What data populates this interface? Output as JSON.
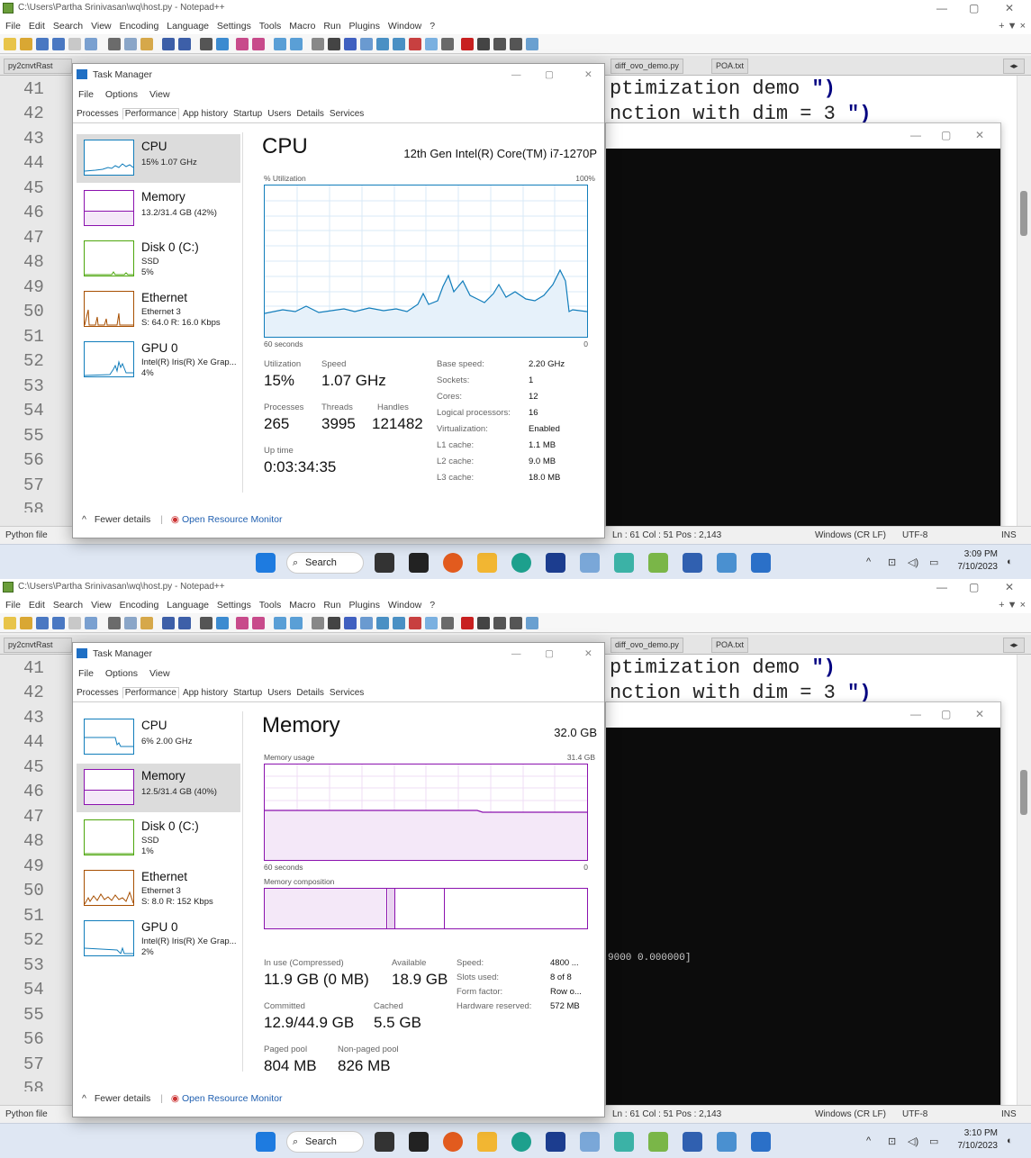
{
  "shots": [
    {
      "notepad": {
        "title": "C:\\Users\\Partha Srinivasan\\wq\\host.py - Notepad++",
        "menu": [
          "File",
          "Edit",
          "Search",
          "View",
          "Encoding",
          "Language",
          "Settings",
          "Tools",
          "Macro",
          "Run",
          "Plugins",
          "Window",
          "?"
        ],
        "menu_right": "+  ▼  ×",
        "tabs": [
          "py2cnvtRast",
          "diff_ovo_demo.py",
          "POA.txt"
        ],
        "lines": [
          "41",
          "42",
          "43",
          "44",
          "45",
          "46",
          "47",
          "48",
          "49",
          "50",
          "51",
          "52",
          "53",
          "54",
          "55",
          "56",
          "57",
          "58"
        ],
        "code_line1": "ptimization demo ",
        "code_line1_end": "\")",
        "code_line2": "nction with dim = 3 ",
        "code_line2_end": "\")",
        "status_type": "Python file",
        "status_pos": "Ln : 61   Col : 51   Pos : 2,143",
        "status_eol": "Windows (CR LF)",
        "status_enc": "UTF-8",
        "status_ins": "INS"
      },
      "console": {
        "text": ""
      },
      "taskbar": {
        "search": "Search",
        "time": "3:09 PM",
        "date": "7/10/2023"
      },
      "tm": {
        "title": "Task Manager",
        "menu": [
          "File",
          "Options",
          "View"
        ],
        "tabs": [
          "Processes",
          "Performance",
          "App history",
          "Startup",
          "Users",
          "Details",
          "Services"
        ],
        "side": [
          {
            "name": "CPU",
            "l1": "15% 1.07 GHz",
            "l2": "",
            "l3": ""
          },
          {
            "name": "Memory",
            "l1": "13.2/31.4 GB (42%)",
            "l2": "",
            "l3": ""
          },
          {
            "name": "Disk 0 (C:)",
            "l1": "SSD",
            "l2": "5%",
            "l3": ""
          },
          {
            "name": "Ethernet",
            "l1": "Ethernet 3",
            "l2": "S: 64.0  R: 16.0 Kbps",
            "l3": ""
          },
          {
            "name": "GPU 0",
            "l1": "Intel(R) Iris(R) Xe Grap...",
            "l2": "4%",
            "l3": ""
          }
        ],
        "header": "CPU",
        "header_right": "12th Gen Intel(R) Core(TM) i7-1270P",
        "util_label": "% Utilization",
        "util_max": "100%",
        "sec_label": "60 seconds",
        "zero": "0",
        "stats": {
          "utilization_label": "Utilization",
          "utilization": "15%",
          "speed_label": "Speed",
          "speed": "1.07 GHz",
          "processes_label": "Processes",
          "processes": "265",
          "threads_label": "Threads",
          "threads": "3995",
          "handles_label": "Handles",
          "handles": "121482",
          "uptime_label": "Up time",
          "uptime": "0:03:34:35"
        },
        "specs": [
          [
            "Base speed:",
            "2.20 GHz"
          ],
          [
            "Sockets:",
            "1"
          ],
          [
            "Cores:",
            "12"
          ],
          [
            "Logical processors:",
            "16"
          ],
          [
            "Virtualization:",
            "Enabled"
          ],
          [
            "L1 cache:",
            "1.1 MB"
          ],
          [
            "L2 cache:",
            "9.0 MB"
          ],
          [
            "L3 cache:",
            "18.0 MB"
          ]
        ],
        "fewer": "Fewer details",
        "monitor": "Open Resource Monitor"
      }
    },
    {
      "notepad": {
        "title": "C:\\Users\\Partha Srinivasan\\wq\\host.py - Notepad++",
        "menu": [
          "File",
          "Edit",
          "Search",
          "View",
          "Encoding",
          "Language",
          "Settings",
          "Tools",
          "Macro",
          "Run",
          "Plugins",
          "Window",
          "?"
        ],
        "menu_right": "+  ▼  ×",
        "tabs": [
          "py2cnvtRast",
          "diff_ovo_demo.py",
          "POA.txt"
        ],
        "lines": [
          "41",
          "42",
          "43",
          "44",
          "45",
          "46",
          "47",
          "48",
          "49",
          "50",
          "51",
          "52",
          "53",
          "54",
          "55",
          "56",
          "57",
          "58"
        ],
        "code_line1": "ptimization demo ",
        "code_line1_end": "\")",
        "code_line2": "nction with dim = 3 ",
        "code_line2_end": "\")",
        "status_type": "Python file",
        "status_pos": "Ln : 61   Col : 51   Pos : 2,143",
        "status_eol": "Windows (CR LF)",
        "status_enc": "UTF-8",
        "status_ins": "INS"
      },
      "console": {
        "text": "9000  0.000000]"
      },
      "taskbar": {
        "search": "Search",
        "time": "3:10 PM",
        "date": "7/10/2023"
      },
      "tm": {
        "title": "Task Manager",
        "menu": [
          "File",
          "Options",
          "View"
        ],
        "tabs": [
          "Processes",
          "Performance",
          "App history",
          "Startup",
          "Users",
          "Details",
          "Services"
        ],
        "side": [
          {
            "name": "CPU",
            "l1": "6% 2.00 GHz",
            "l2": "",
            "l3": ""
          },
          {
            "name": "Memory",
            "l1": "12.5/31.4 GB (40%)",
            "l2": "",
            "l3": ""
          },
          {
            "name": "Disk 0 (C:)",
            "l1": "SSD",
            "l2": "1%",
            "l3": ""
          },
          {
            "name": "Ethernet",
            "l1": "Ethernet 3",
            "l2": "S: 8.0  R: 152 Kbps",
            "l3": ""
          },
          {
            "name": "GPU 0",
            "l1": "Intel(R) Iris(R) Xe Grap...",
            "l2": "2%",
            "l3": ""
          }
        ],
        "header": "Memory",
        "header_right": "32.0 GB",
        "usage_label": "Memory usage",
        "usage_max": "31.4 GB",
        "sec_label": "60 seconds",
        "zero": "0",
        "comp_label": "Memory composition",
        "stats": {
          "inuse_label": "In use (Compressed)",
          "inuse": "11.9 GB (0 MB)",
          "avail_label": "Available",
          "avail": "18.9 GB",
          "commit_label": "Committed",
          "commit": "12.9/44.9 GB",
          "cached_label": "Cached",
          "cached": "5.5 GB",
          "paged_label": "Paged pool",
          "paged": "804 MB",
          "nonpaged_label": "Non-paged pool",
          "nonpaged": "826 MB"
        },
        "specs": [
          [
            "Speed:",
            "4800 ..."
          ],
          [
            "Slots used:",
            "8 of 8"
          ],
          [
            "Form factor:",
            "Row o..."
          ],
          [
            "Hardware reserved:",
            "572 MB"
          ]
        ],
        "fewer": "Fewer details",
        "monitor": "Open Resource Monitor"
      }
    }
  ],
  "colors": {
    "cpu": "#117dbb",
    "memory": "#8b12ae",
    "disk": "#4da60c",
    "ethernet": "#a74f01",
    "gpu": "#117dbb",
    "code_kw": "#000080"
  }
}
